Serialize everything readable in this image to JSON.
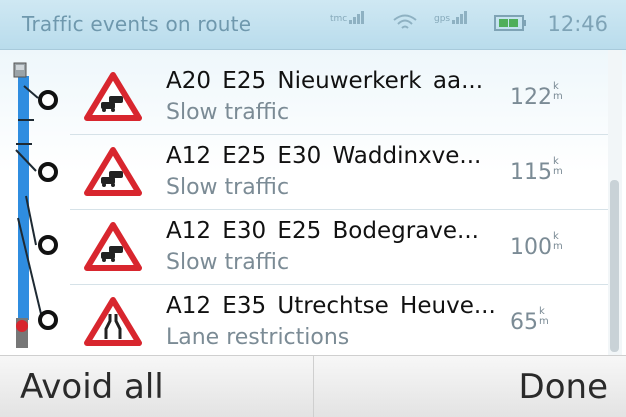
{
  "header": {
    "title": "Traffic events on route",
    "network_label": "tmc",
    "wifi_icon": "wifi-icon",
    "gps_label": "gps",
    "battery_icon": "battery-icon",
    "time": "12:46"
  },
  "events": [
    {
      "roads": "A20  E25  Nieuwerkerk aa...",
      "type": "Slow traffic",
      "distance": "122",
      "unit_top": "k",
      "unit_bottom": "m",
      "icon": "traffic-jam-warning-icon"
    },
    {
      "roads": "A12  E25  E30  Waddinxve...",
      "type": "Slow traffic",
      "distance": "115",
      "unit_top": "k",
      "unit_bottom": "m",
      "icon": "traffic-jam-warning-icon"
    },
    {
      "roads": "A12  E30  E25  Bodegrave...",
      "type": "Slow traffic",
      "distance": "100",
      "unit_top": "k",
      "unit_bottom": "m",
      "icon": "traffic-jam-warning-icon"
    },
    {
      "roads": "A12  E35  Utrechtse Heuve...",
      "type": "Lane restrictions",
      "distance": "65",
      "unit_top": "k",
      "unit_bottom": "m",
      "icon": "road-narrows-warning-icon"
    }
  ],
  "buttons": {
    "avoid_all": "Avoid all",
    "done": "Done"
  },
  "colors": {
    "warning_red": "#d8262e",
    "route_blue": "#2f8de0",
    "header_bg": "#c3e2f0"
  }
}
